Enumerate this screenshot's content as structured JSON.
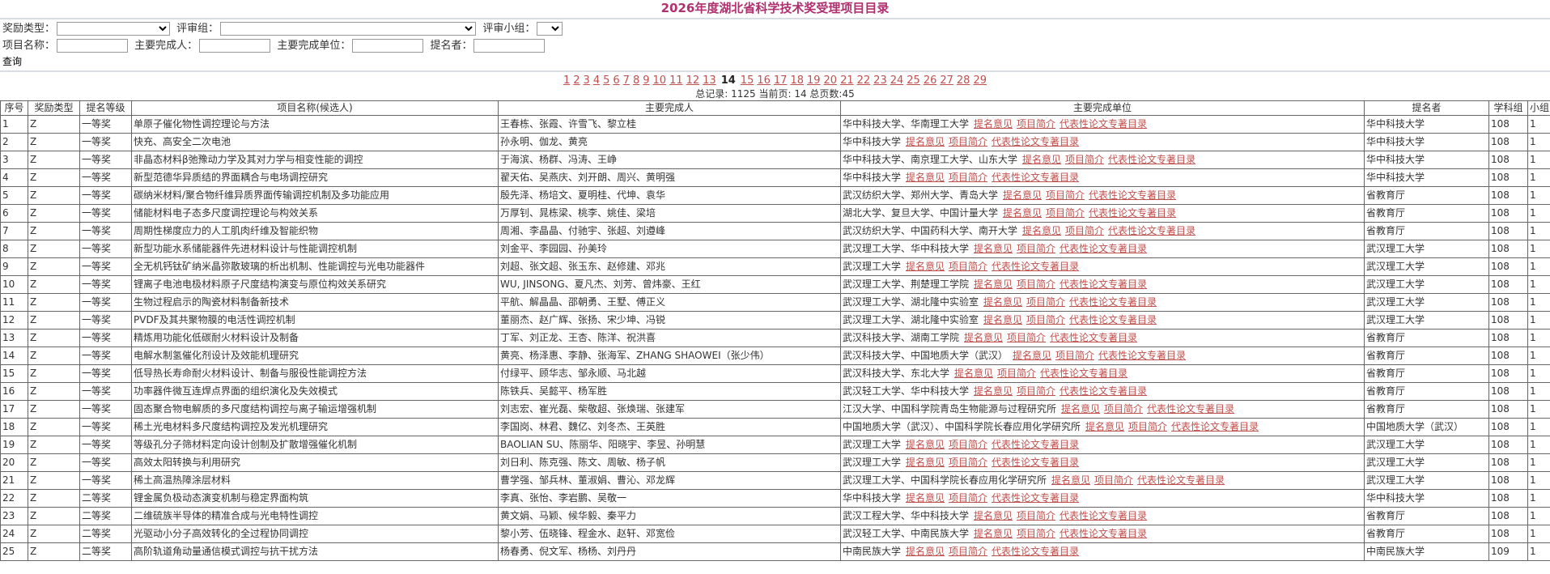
{
  "page_title": "2026年度湖北省科学技术奖受理项目目录",
  "filters": {
    "award_type_label": "奖励类型：",
    "review_group_label": "评审组：",
    "review_subgroup_label": "评审小组：",
    "project_name_label": "项目名称：",
    "main_person_label": "主要完成人：",
    "main_unit_label": "主要完成单位：",
    "nominator_label": "提名者：",
    "query_label": "查询"
  },
  "pagination": {
    "pages_before": [
      "1",
      "2",
      "3",
      "4",
      "5",
      "6",
      "7",
      "8",
      "9",
      "10",
      "11",
      "12",
      "13"
    ],
    "current": "14",
    "pages_after": [
      "15",
      "16",
      "17",
      "18",
      "19",
      "20",
      "21",
      "22",
      "23",
      "24",
      "25",
      "26",
      "27",
      "28",
      "29"
    ],
    "summary": "总记录: 1125  当前页: 14 总页数:45"
  },
  "table": {
    "headers": [
      "序号",
      "奖励类型",
      "提名等级",
      "项目名称(候选人)",
      "主要完成人",
      "主要完成单位",
      "提名者",
      "学科组",
      "小组"
    ],
    "link_labels": [
      "提名意见",
      "项目简介",
      "代表性论文专著目录"
    ],
    "rows": [
      [
        "1",
        "Z",
        "一等奖",
        "单原子催化物性调控理论与方法",
        "王春栋、张霞、许雪飞、黎立桂",
        "华中科技大学、华南理工大学",
        "华中科技大学",
        "108",
        "1"
      ],
      [
        "2",
        "Z",
        "一等奖",
        "快充、高安全二次电池",
        "孙永明、伽龙、黄亮",
        "华中科技大学",
        "华中科技大学",
        "108",
        "1"
      ],
      [
        "3",
        "Z",
        "一等奖",
        "非晶态材料β弛豫动力学及其对力学与相变性能的调控",
        "于海滨、杨群、冯涛、王峥",
        "华中科技大学、南京理工大学、山东大学",
        "华中科技大学",
        "108",
        "1"
      ],
      [
        "4",
        "Z",
        "一等奖",
        "新型范德华异质结的界面耦合与电场调控研究",
        "翟天佑、吴燕庆、刘开朗、周兴、黄明强",
        "华中科技大学",
        "华中科技大学",
        "108",
        "1"
      ],
      [
        "5",
        "Z",
        "一等奖",
        "碳纳米材料/聚合物纤维异质界面传输调控机制及多功能应用",
        "殷先泽、杨培文、夏明桂、代坤、袁华",
        "武汉纺织大学、郑州大学、青岛大学",
        "省教育厅",
        "108",
        "1"
      ],
      [
        "6",
        "Z",
        "一等奖",
        "储能材料电子态多尺度调控理论与构效关系",
        "万厚钊、晁栋梁、桃李、姚佳、梁培",
        "湖北大学、复旦大学、中国计量大学",
        "省教育厅",
        "108",
        "1"
      ],
      [
        "7",
        "Z",
        "一等奖",
        "周期性梯度应力的人工肌肉纤维及智能织物",
        "周湘、李晶晶、付驰宇、张超、刘遵峰",
        "武汉纺织大学、中国药科大学、南开大学",
        "省教育厅",
        "108",
        "1"
      ],
      [
        "8",
        "Z",
        "一等奖",
        "新型功能水系储能器件先进材料设计与性能调控机制",
        "刘金平、李园园、孙美玲",
        "武汉理工大学、华中科技大学",
        "武汉理工大学",
        "108",
        "1"
      ],
      [
        "9",
        "Z",
        "一等奖",
        "全无机钙钛矿纳米晶弥散玻璃的析出机制、性能调控与光电功能器件",
        "刘超、张文超、张玉东、赵修建、邓兆",
        "武汉理工大学",
        "武汉理工大学",
        "108",
        "1"
      ],
      [
        "10",
        "Z",
        "一等奖",
        "锂离子电池电极材料原子尺度结构演变与原位构效关系研究",
        "WU, JINSONG、夏凡杰、刘芳、曾炜豪、王红",
        "武汉理工大学、荆楚理工学院",
        "武汉理工大学",
        "108",
        "1"
      ],
      [
        "11",
        "Z",
        "一等奖",
        "生物过程启示的陶瓷材料制备新技术",
        "平航、解晶晶、邵朝勇、王墅、傅正义",
        "武汉理工大学、湖北隆中实验室",
        "武汉理工大学",
        "108",
        "1"
      ],
      [
        "12",
        "Z",
        "一等奖",
        "PVDF及其共聚物膜的电活性调控机制",
        "董丽杰、赵广辉、张扬、宋少坤、冯锐",
        "武汉理工大学、湖北隆中实验室",
        "武汉理工大学",
        "108",
        "1"
      ],
      [
        "13",
        "Z",
        "一等奖",
        "精炼用功能化低碳耐火材料设计及制备",
        "丁军、刘正龙、王杏、陈洋、祝洪喜",
        "武汉科技大学、湖南工学院",
        "省教育厅",
        "108",
        "1"
      ],
      [
        "14",
        "Z",
        "一等奖",
        "电解水制氢催化剂设计及效能机理研究",
        "黄亮、杨泽惠、李静、张海军、ZHANG SHAOWEI（张少伟）",
        "武汉科技大学、中国地质大学（武汉）",
        "省教育厅",
        "108",
        "1"
      ],
      [
        "15",
        "Z",
        "一等奖",
        "低导热长寿命耐火材料设计、制备与服役性能调控方法",
        "付绿平、顾华志、邹永顺、马北越",
        "武汉科技大学、东北大学",
        "省教育厅",
        "108",
        "1"
      ],
      [
        "16",
        "Z",
        "一等奖",
        "功率器件微互连焊点界面的组织演化及失效模式",
        "陈铁兵、吴懿平、杨军胜",
        "武汉轻工大学、华中科技大学",
        "省教育厅",
        "108",
        "1"
      ],
      [
        "17",
        "Z",
        "一等奖",
        "固态聚合物电解质的多尺度结构调控与离子输运增强机制",
        "刘志宏、崔光磊、柴敬超、张焕瑞、张建军",
        "江汉大学、中国科学院青岛生物能源与过程研究所",
        "省教育厅",
        "108",
        "1"
      ],
      [
        "18",
        "Z",
        "一等奖",
        "稀土光电材料多尺度结构调控及发光机理研究",
        "李国岗、林君、魏亿、刘冬杰、王英胜",
        "中国地质大学（武汉）、中国科学院长春应用化学研究所",
        "中国地质大学（武汉）",
        "108",
        "1"
      ],
      [
        "19",
        "Z",
        "一等奖",
        "等级孔分子筛材料定向设计创制及扩散增强催化机制",
        "BAOLIAN SU、陈丽华、阳晓宇、李昱、孙明慧",
        "武汉理工大学",
        "武汉理工大学",
        "108",
        "1"
      ],
      [
        "20",
        "Z",
        "一等奖",
        "高效太阳转换与利用研究",
        "刘日利、陈克强、陈文、周敏、杨子帆",
        "武汉理工大学",
        "武汉理工大学",
        "108",
        "1"
      ],
      [
        "21",
        "Z",
        "一等奖",
        "稀土高温热障涂层材料",
        "曹学强、邹兵林、董淑娟、曹沁、邓龙辉",
        "武汉理工大学、中国科学院长春应用化学研究所",
        "武汉理工大学",
        "108",
        "1"
      ],
      [
        "22",
        "Z",
        "二等奖",
        "锂金属负极动态演变机制与稳定界面构筑",
        "李真、张怡、李岩鹏、吴敬一",
        "华中科技大学",
        "华中科技大学",
        "108",
        "1"
      ],
      [
        "23",
        "Z",
        "二等奖",
        "二维硫族半导体的精准合成与光电特性调控",
        "黄文娟、马颖、候华毅、秦平力",
        "武汉工程大学、华中科技大学",
        "省教育厅",
        "108",
        "1"
      ],
      [
        "24",
        "Z",
        "二等奖",
        "光驱动小分子高效转化的全过程协同调控",
        "黎小芳、伍晓锋、程金水、赵轩、邓宽俭",
        "武汉轻工大学、中南民族大学",
        "省教育厅",
        "108",
        "1"
      ],
      [
        "25",
        "Z",
        "二等奖",
        "高阶轨道角动量通信模式调控与抗干扰方法",
        "杨春勇、倪文军、杨杨、刘丹丹",
        "中南民族大学",
        "中南民族大学",
        "109",
        "1"
      ]
    ]
  }
}
